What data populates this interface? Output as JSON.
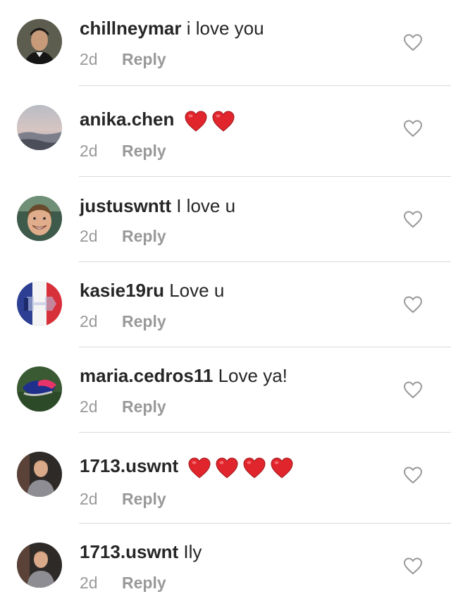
{
  "comments": [
    {
      "username": "chillneymar",
      "text": "i love you",
      "hearts": 0,
      "time": "2d",
      "reply": "Reply",
      "avatar": "avatar-man-dark-hair"
    },
    {
      "username": "anika.chen",
      "text": "",
      "hearts": 2,
      "time": "2d",
      "reply": "Reply",
      "avatar": "avatar-sunset-landscape"
    },
    {
      "username": "justuswntt",
      "text": "I love u",
      "hearts": 0,
      "time": "2d",
      "reply": "Reply",
      "avatar": "avatar-smiling-face"
    },
    {
      "username": "kasie19ru",
      "text": "Love u",
      "hearts": 0,
      "time": "2d",
      "reply": "Reply",
      "avatar": "avatar-flag"
    },
    {
      "username": "maria.cedros11",
      "text": "Love ya!",
      "hearts": 0,
      "time": "2d",
      "reply": "Reply",
      "avatar": "avatar-soccer-cleats"
    },
    {
      "username": "1713.uswnt",
      "text": "",
      "hearts": 4,
      "time": "2d",
      "reply": "Reply",
      "avatar": "avatar-woman-gray-shirt"
    },
    {
      "username": "1713.uswnt",
      "text": "Ily",
      "hearts": 0,
      "time": "2d",
      "reply": "Reply",
      "avatar": "avatar-woman-gray-shirt"
    }
  ],
  "icons": {
    "like": "heart-outline-icon",
    "heart_emoji": "red-heart-emoji"
  },
  "colors": {
    "text": "#262626",
    "secondary": "#999999",
    "divider": "#dbdbdb",
    "heart_red": "#e0252c"
  }
}
